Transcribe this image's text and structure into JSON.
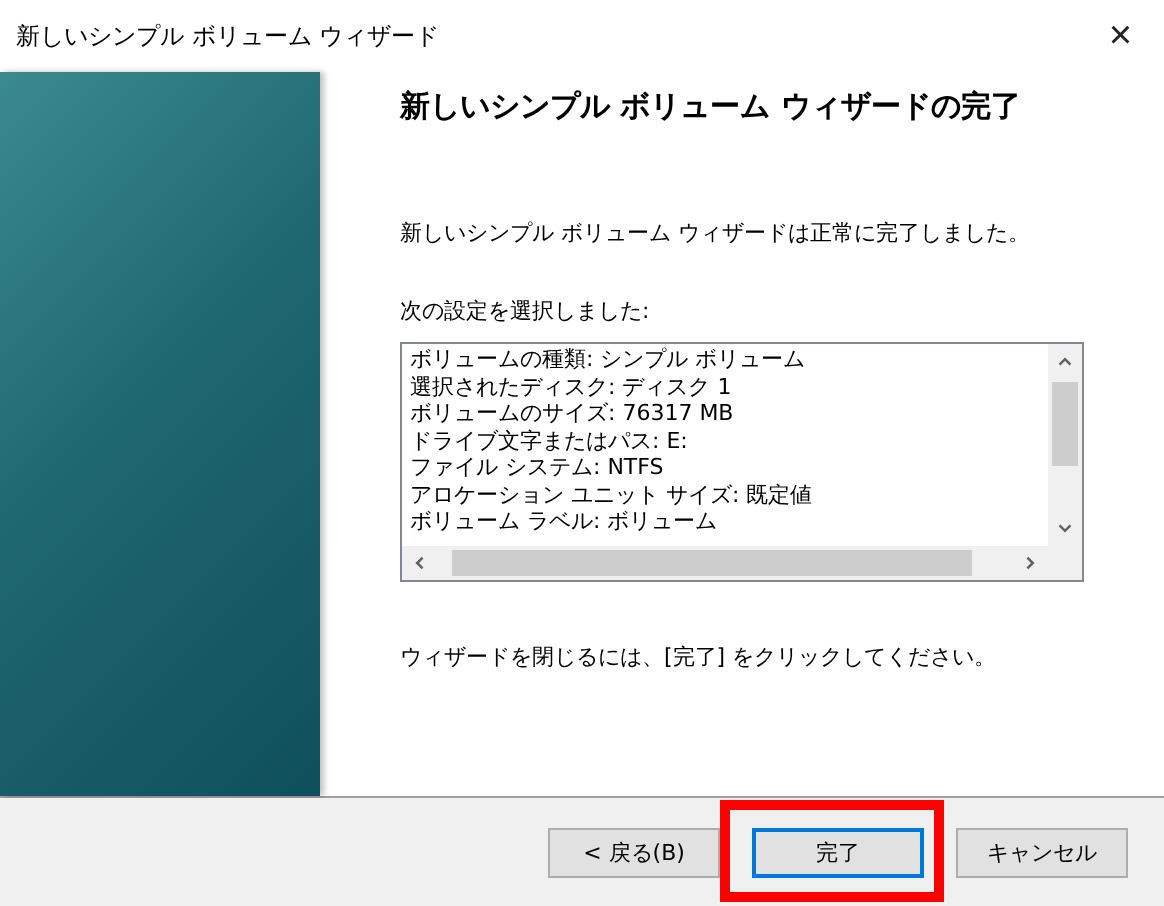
{
  "window": {
    "title": "新しいシンプル ボリューム ウィザード",
    "close": "×"
  },
  "heading": "新しいシンプル ボリューム ウィザードの完了",
  "message": "新しいシンプル ボリューム ウィザードは正常に完了しました。",
  "settings_label": "次の設定を選択しました:",
  "settings": [
    "ボリュームの種類: シンプル ボリューム",
    "選択されたディスク: ディスク 1",
    "ボリュームのサイズ: 76317 MB",
    "ドライブ文字またはパス: E:",
    "ファイル システム: NTFS",
    "アロケーション ユニット サイズ: 既定値",
    "ボリューム ラベル: ボリューム"
  ],
  "instruction": "ウィザードを閉じるには、[完了] をクリックしてください。",
  "buttons": [
    {
      "label": "< 戻る(B)",
      "default": false,
      "highlighted": false
    },
    {
      "label": "完了",
      "default": true,
      "highlighted": true
    },
    {
      "label": "キャンセル",
      "default": false,
      "highlighted": false
    }
  ]
}
